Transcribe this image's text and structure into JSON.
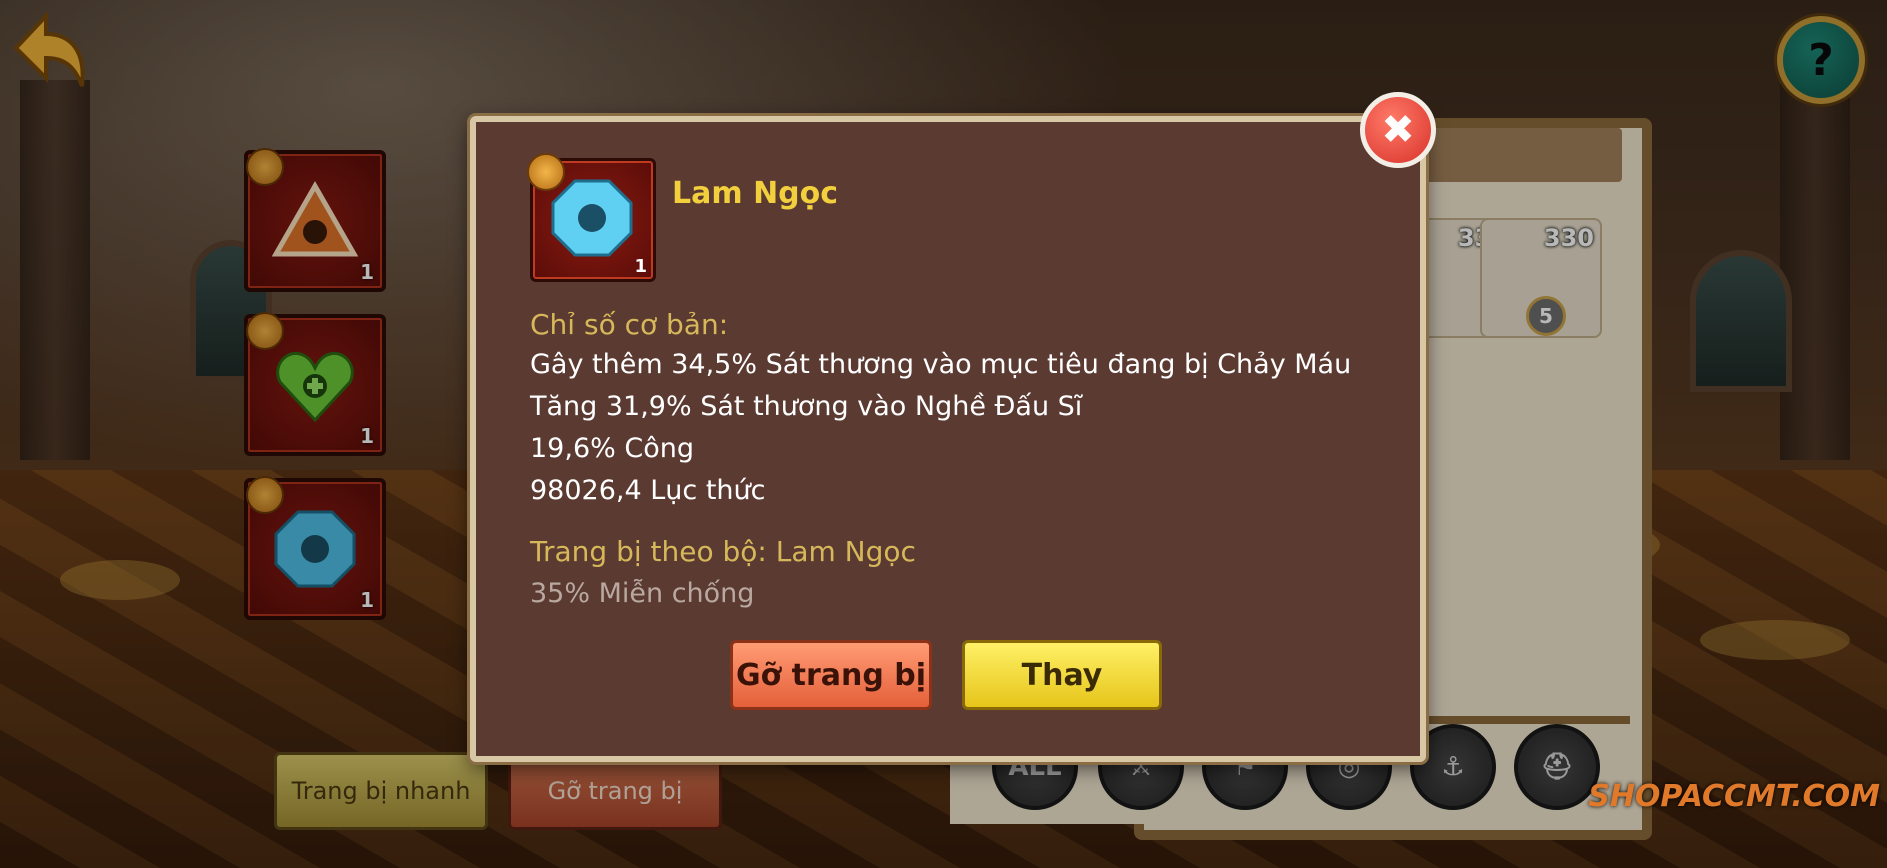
{
  "item": {
    "name": "Lam Ngọc",
    "count": "1",
    "section_basic": "Chỉ số cơ bản:",
    "stats": [
      "Gây thêm 34,5% Sát thương vào mục tiêu đang bị Chảy Máu",
      "Tăng 31,9% Sát thương vào Nghề Đấu Sĩ",
      "19,6% Công",
      "98026,4 Lục thức"
    ],
    "set_title": "Trang bị theo bộ: Lam Ngọc",
    "set_bonus": "35% Miễn chống"
  },
  "modal_buttons": {
    "remove": "Gỡ trang bị",
    "replace": "Thay"
  },
  "equip_slots": [
    {
      "icon": "fist-triangle-icon",
      "count": "1"
    },
    {
      "icon": "green-heart-icon",
      "count": "1"
    },
    {
      "icon": "blue-gem-icon",
      "count": "1"
    }
  ],
  "bottom_buttons": {
    "quick_equip": "Trang bị nhanh",
    "remove_all": "Gỡ trang bị"
  },
  "heroes": [
    {
      "power": "330",
      "stars": ""
    },
    {
      "power": "330",
      "stars": "5"
    }
  ],
  "filters": [
    "ALL",
    "",
    "",
    "",
    "",
    ""
  ],
  "help_label": "?",
  "close_label": "✖",
  "watermark": "SHOPACCMT.COM",
  "colors": {
    "accent_gold": "#f2cf3c",
    "modal_bg": "#5b3a32"
  }
}
